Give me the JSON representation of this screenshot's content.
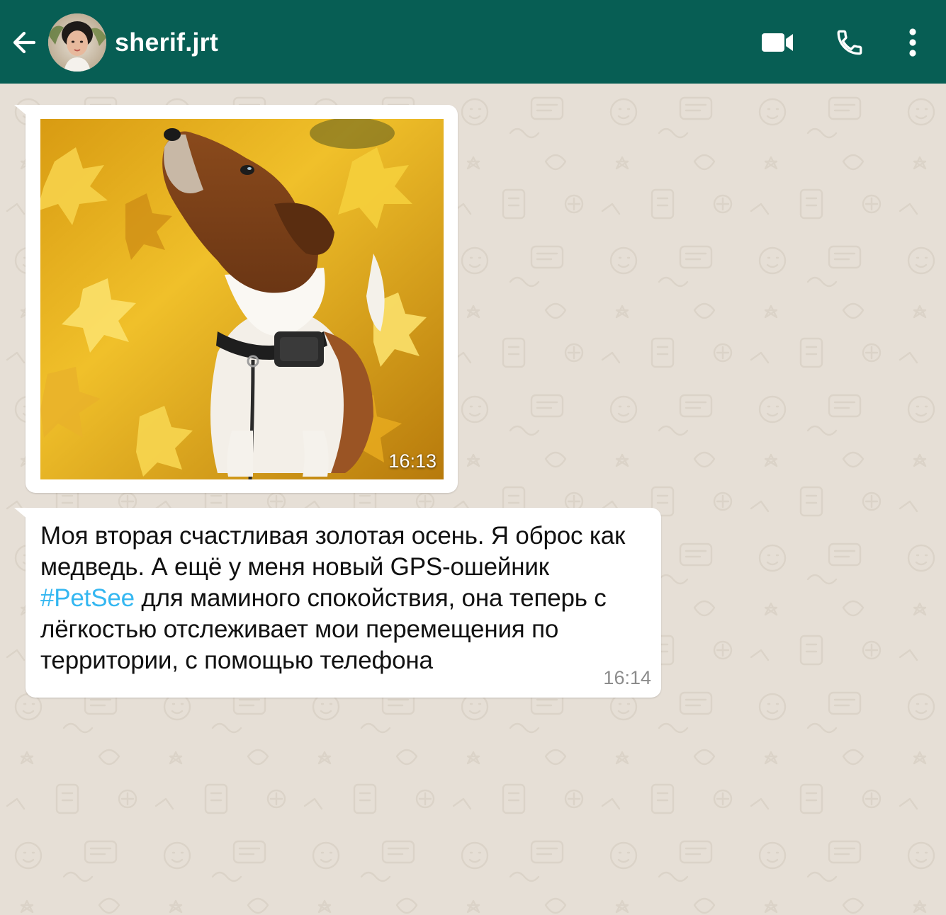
{
  "header": {
    "contact_name": "sherif.jrt",
    "background_color": "#075e54",
    "icons": [
      "back-arrow-icon",
      "video-camera-icon",
      "phone-icon",
      "more-vertical-icon"
    ]
  },
  "messages": [
    {
      "type": "image",
      "image_alt": "dog-photo",
      "time": "16:13"
    },
    {
      "type": "text",
      "text_before": "Моя вторая счастливая золотая осень. Я оброс как медведь. А ещё у меня новый GPS-ошейник ",
      "hashtag": "#PetSee",
      "text_after": " для маминого спокойствия, она теперь с лёгкостью отслеживает мои перемещения по территории, с помощью телефона",
      "time": "16:14"
    }
  ],
  "colors": {
    "chat_background": "#e6dfd6",
    "bubble": "#ffffff",
    "hashtag": "#34b7f1"
  }
}
